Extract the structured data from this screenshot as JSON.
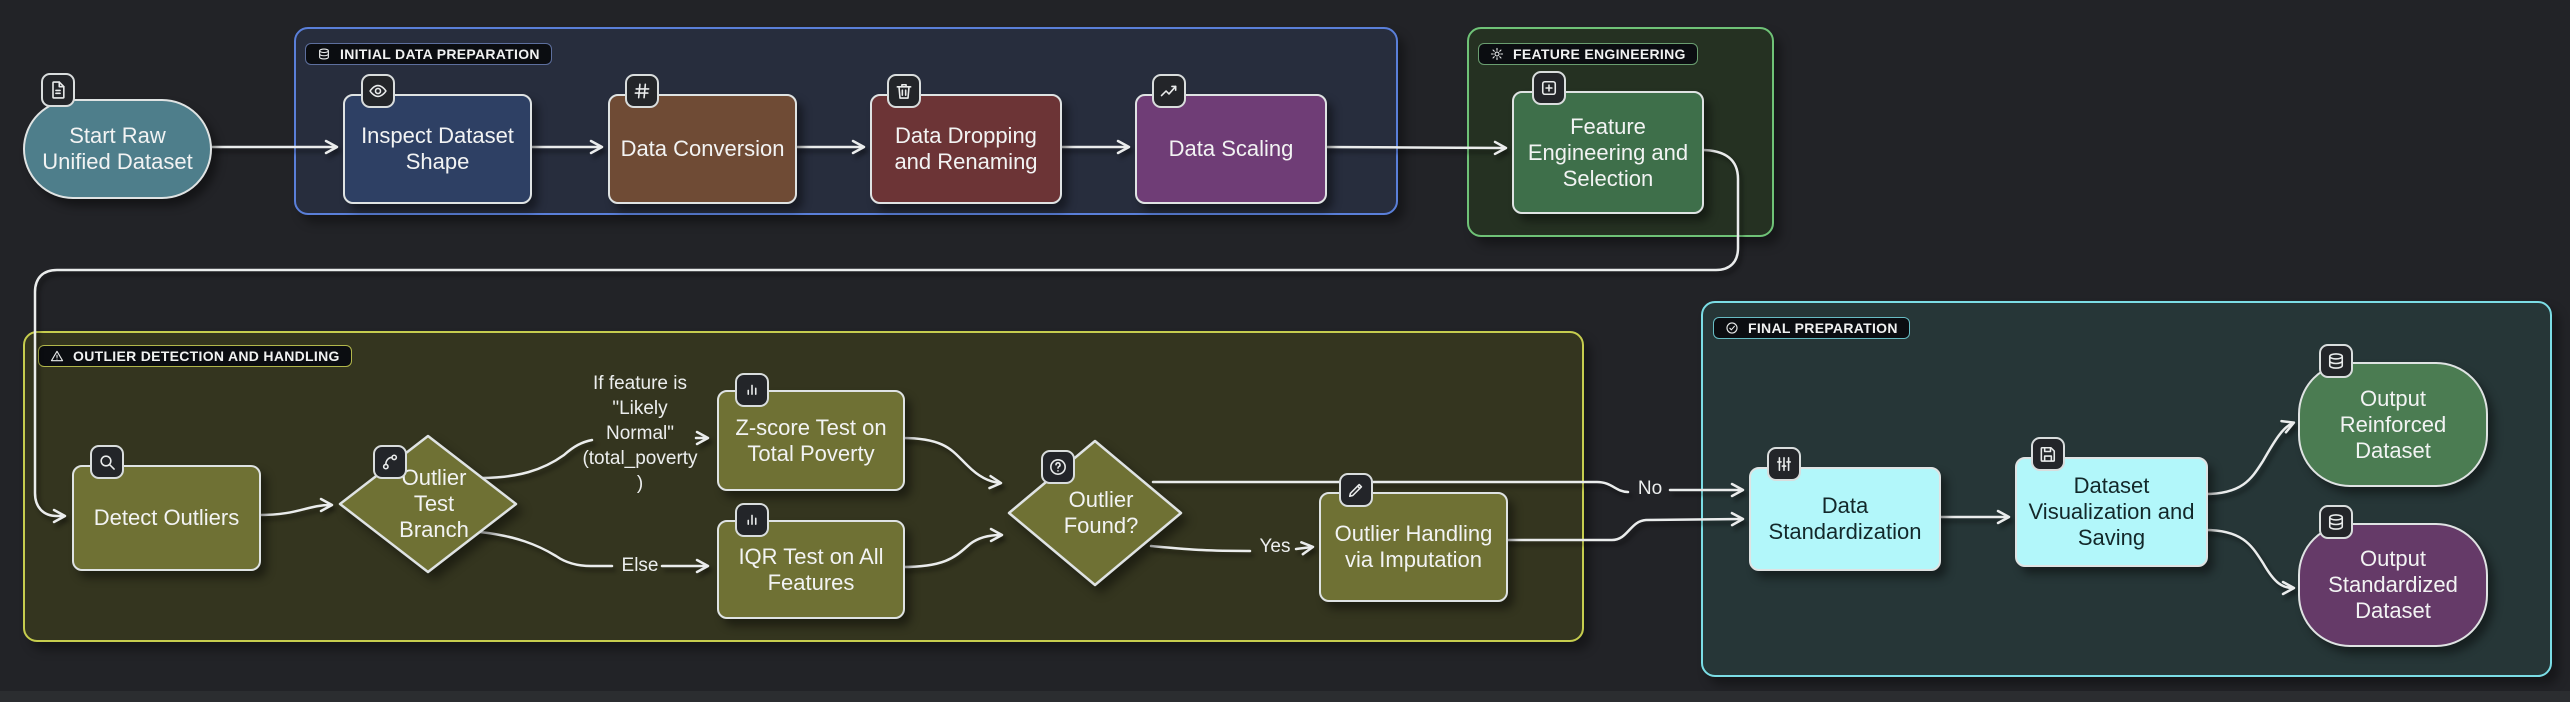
{
  "page": {
    "background": "#222327",
    "edge_color": "#eaecec",
    "node_border_color": "#dfe3e3",
    "badge_background": "#232529",
    "chip_background": "#0b0d11"
  },
  "diagram": {
    "subgraphs": [
      {
        "id": "prep",
        "label": "INITIAL DATA PREPARATION",
        "icon": "database-icon",
        "border_color": "#5a7fd9",
        "fill": "#272d3d",
        "chip_border": "#5d6f9e"
      },
      {
        "id": "feat",
        "label": "FEATURE ENGINEERING",
        "icon": "gear-icon",
        "border_color": "#6fc277",
        "fill": "#253122",
        "chip_border": "#6a9e70"
      },
      {
        "id": "outlier",
        "label": "OUTLIER DETECTION AND HANDLING",
        "icon": "warning-icon",
        "border_color": "#c6cd4e",
        "fill": "#34351f",
        "chip_border": "#b2b74b"
      },
      {
        "id": "final",
        "label": "FINAL PREPARATION",
        "icon": "check-circle-icon",
        "border_color": "#7bdde5",
        "fill": "#263637",
        "chip_border": "#67bcc4"
      }
    ],
    "nodes": [
      {
        "id": "start",
        "label": "Start Raw\nUnified Dataset",
        "shape": "stadium",
        "icon": "file-icon",
        "fill": "#4e7e8b",
        "text_color": "#f2f3f3"
      },
      {
        "id": "inspect",
        "label": "Inspect Dataset\nShape",
        "shape": "rect",
        "icon": "eye-icon",
        "fill": "#2e4064",
        "text_color": "#f2f3f3"
      },
      {
        "id": "conversion",
        "label": "Data Conversion",
        "shape": "rect",
        "icon": "hash-icon",
        "fill": "#6f4b35",
        "text_color": "#f2f3f3"
      },
      {
        "id": "dropping",
        "label": "Data Dropping\nand Renaming",
        "shape": "rect",
        "icon": "trash-icon",
        "fill": "#6c3436",
        "text_color": "#f2f3f3"
      },
      {
        "id": "scaling",
        "label": "Data Scaling",
        "shape": "rect",
        "icon": "trend-up-icon",
        "fill": "#6f3d76",
        "text_color": "#f2f3f3"
      },
      {
        "id": "feature",
        "label": "Feature\nEngineering and\nSelection",
        "shape": "rect",
        "icon": "plus-square-icon",
        "fill": "#3e6f4a",
        "text_color": "#f2f3f3"
      },
      {
        "id": "detect",
        "label": "Detect Outliers",
        "shape": "rect",
        "icon": "search-icon",
        "fill": "#6f7134",
        "text_color": "#f2f3f3"
      },
      {
        "id": "branch",
        "label": "Outlier\nTest\nBranch",
        "shape": "diamond",
        "icon": "branch-icon",
        "fill": "#6f7134",
        "text_color": "#f2f3f3"
      },
      {
        "id": "zscore",
        "label": "Z-score Test on\nTotal Poverty",
        "shape": "rect",
        "icon": "bar-chart-icon",
        "fill": "#6f7134",
        "text_color": "#f2f3f3"
      },
      {
        "id": "iqr",
        "label": "IQR Test on All\nFeatures",
        "shape": "rect",
        "icon": "bar-chart-icon",
        "fill": "#6f7134",
        "text_color": "#f2f3f3"
      },
      {
        "id": "found",
        "label": "Outlier\nFound?",
        "shape": "diamond",
        "icon": "help-icon",
        "fill": "#6f7134",
        "text_color": "#f2f3f3"
      },
      {
        "id": "imputation",
        "label": "Outlier Handling\nvia Imputation",
        "shape": "rect",
        "icon": "pencil-icon",
        "fill": "#6f7134",
        "text_color": "#f2f3f3"
      },
      {
        "id": "standardization",
        "label": "Data\nStandardization",
        "shape": "rect",
        "icon": "sliders-icon",
        "fill": "#b2f7fa",
        "text_color": "#13282a"
      },
      {
        "id": "viz",
        "label": "Dataset\nVisualization and\nSaving",
        "shape": "rect",
        "icon": "save-icon",
        "fill": "#b2f7fa",
        "text_color": "#13282a"
      },
      {
        "id": "out_reinforced",
        "label": "Output\nReinforced\nDataset",
        "shape": "stadium",
        "icon": "database-icon",
        "fill": "#4b7c52",
        "text_color": "#f2f3f3"
      },
      {
        "id": "out_standardized",
        "label": "Output\nStandardized\nDataset",
        "shape": "stadium",
        "icon": "database-icon",
        "fill": "#653a68",
        "text_color": "#f2f3f3"
      }
    ],
    "edges": [
      {
        "from": "start",
        "to": "inspect",
        "label": ""
      },
      {
        "from": "inspect",
        "to": "conversion",
        "label": ""
      },
      {
        "from": "conversion",
        "to": "dropping",
        "label": ""
      },
      {
        "from": "dropping",
        "to": "scaling",
        "label": ""
      },
      {
        "from": "scaling",
        "to": "feature",
        "label": ""
      },
      {
        "from": "feature",
        "to": "detect",
        "label": ""
      },
      {
        "from": "detect",
        "to": "branch",
        "label": ""
      },
      {
        "from": "branch",
        "to": "zscore",
        "label": "If feature is\n\"Likely\nNormal\"\n(total_poverty\n)"
      },
      {
        "from": "branch",
        "to": "iqr",
        "label": "Else"
      },
      {
        "from": "zscore",
        "to": "found",
        "label": ""
      },
      {
        "from": "iqr",
        "to": "found",
        "label": ""
      },
      {
        "from": "found",
        "to": "standardization",
        "label": "No"
      },
      {
        "from": "found",
        "to": "imputation",
        "label": "Yes"
      },
      {
        "from": "imputation",
        "to": "standardization",
        "label": ""
      },
      {
        "from": "standardization",
        "to": "viz",
        "label": ""
      },
      {
        "from": "viz",
        "to": "out_reinforced",
        "label": ""
      },
      {
        "from": "viz",
        "to": "out_standardized",
        "label": ""
      }
    ]
  }
}
